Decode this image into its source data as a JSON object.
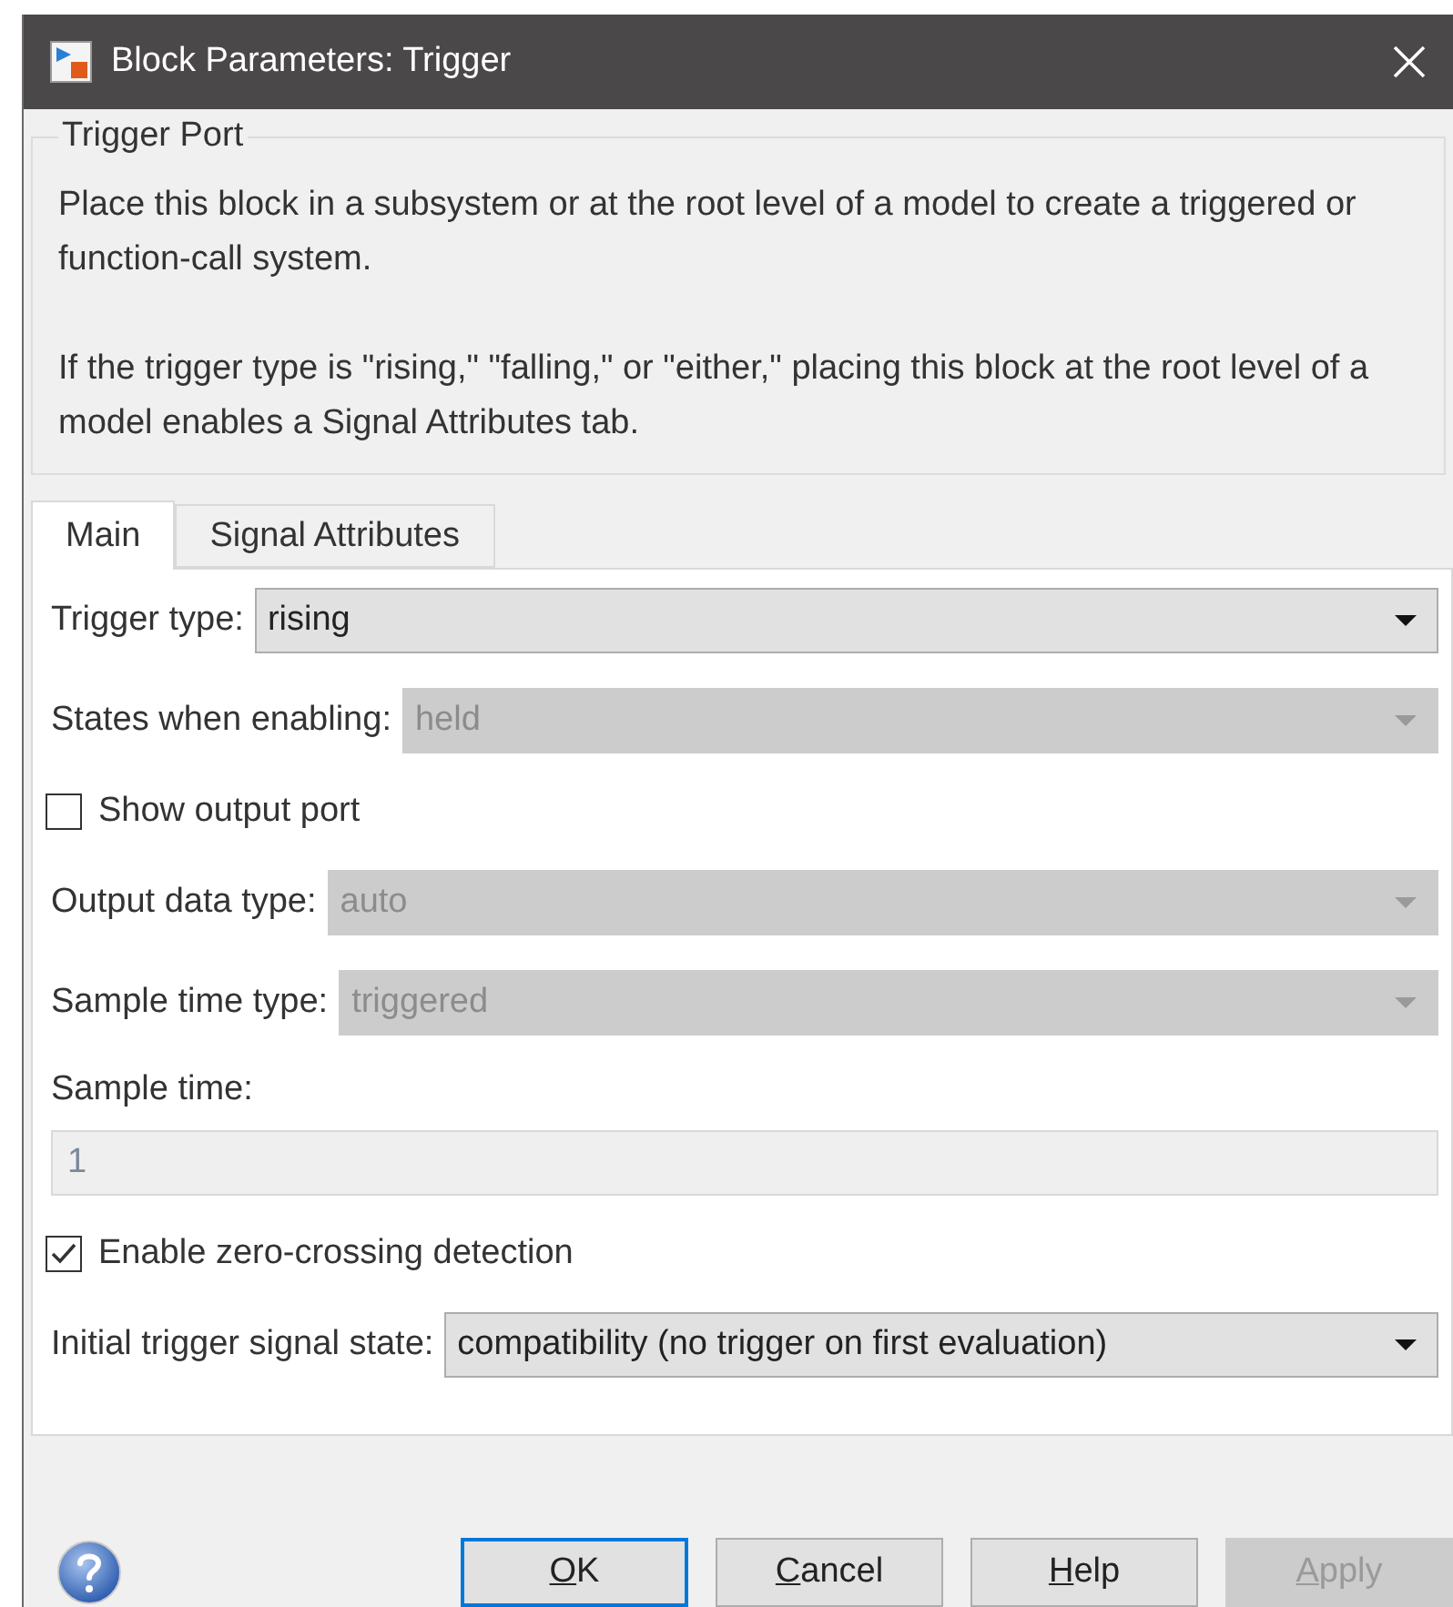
{
  "window": {
    "title": "Block Parameters: Trigger"
  },
  "description": {
    "title": "Trigger Port",
    "paragraphs": [
      "Place this block in a subsystem or at the root level of a model to create a triggered or function-call system.",
      "If the trigger type is \"rising,\" \"falling,\" or \"either,\" placing this block at the root level of a model enables a Signal Attributes tab."
    ]
  },
  "tabs": [
    {
      "label": "Main",
      "selected": true
    },
    {
      "label": "Signal Attributes",
      "selected": false
    }
  ],
  "fields": [
    {
      "kind": "dropdown",
      "label": "Trigger type:",
      "value": "rising",
      "disabled": false
    },
    {
      "kind": "dropdown",
      "label": "States when enabling:",
      "value": "held",
      "disabled": true
    },
    {
      "kind": "checkbox",
      "label": "Show output port",
      "checked": false
    },
    {
      "kind": "dropdown",
      "label": "Output data type:",
      "value": "auto",
      "disabled": true
    },
    {
      "kind": "dropdown",
      "label": "Sample time type:",
      "value": "triggered",
      "disabled": true
    },
    {
      "kind": "text",
      "label": "Sample time:",
      "value": "1",
      "disabled": true
    },
    {
      "kind": "checkbox",
      "label": "Enable zero-crossing detection",
      "checked": true
    },
    {
      "kind": "dropdown",
      "label": "Initial trigger signal state:",
      "value": "compatibility (no trigger on first evaluation)",
      "disabled": false
    }
  ],
  "buttons": [
    {
      "label": "OK",
      "default": true,
      "disabled": false
    },
    {
      "label": "Cancel",
      "default": false,
      "disabled": false
    },
    {
      "label": "Help",
      "default": false,
      "disabled": false
    },
    {
      "label": "Apply",
      "default": false,
      "disabled": true
    }
  ]
}
